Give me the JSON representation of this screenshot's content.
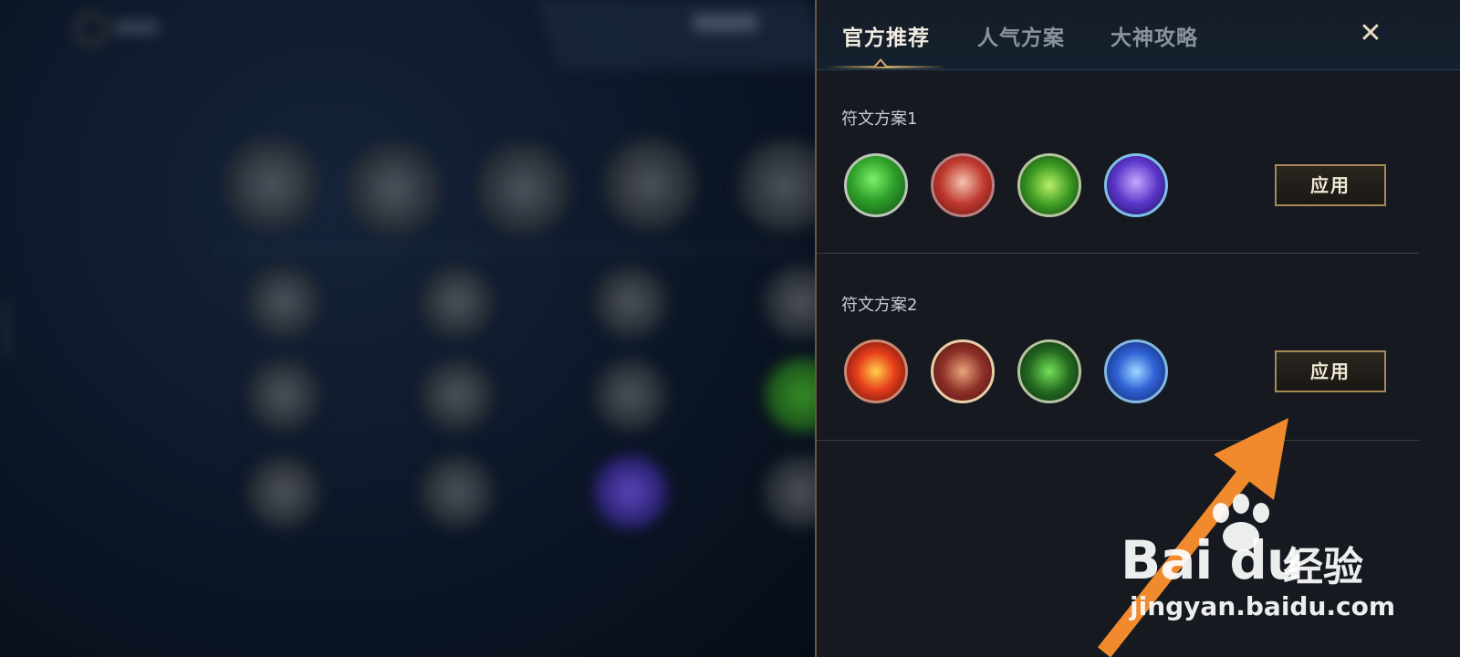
{
  "tabs": [
    {
      "label": "官方推荐",
      "active": true
    },
    {
      "label": "人气方案",
      "active": false
    },
    {
      "label": "大神攻略",
      "active": false
    }
  ],
  "close_icon": "close-icon",
  "plans": [
    {
      "title": "符文方案1",
      "apply_label": "应用",
      "runes": [
        "green-leaf-rune-icon",
        "red-hand-rune-icon",
        "green-swirl-rune-icon",
        "purple-owl-rune-icon"
      ]
    },
    {
      "title": "符文方案2",
      "apply_label": "应用",
      "runes": [
        "red-lightning-rune-icon",
        "red-fist-rune-icon",
        "green-beast-rune-icon",
        "blue-ring-rune-icon"
      ]
    }
  ],
  "watermark": {
    "brand": "Bai du",
    "cn": "经验",
    "url": "jingyan.baidu.com"
  },
  "colors": {
    "accent_gold": "#c9a86a",
    "arrow": "#f08a2c",
    "panel_bg": "#16191f"
  }
}
